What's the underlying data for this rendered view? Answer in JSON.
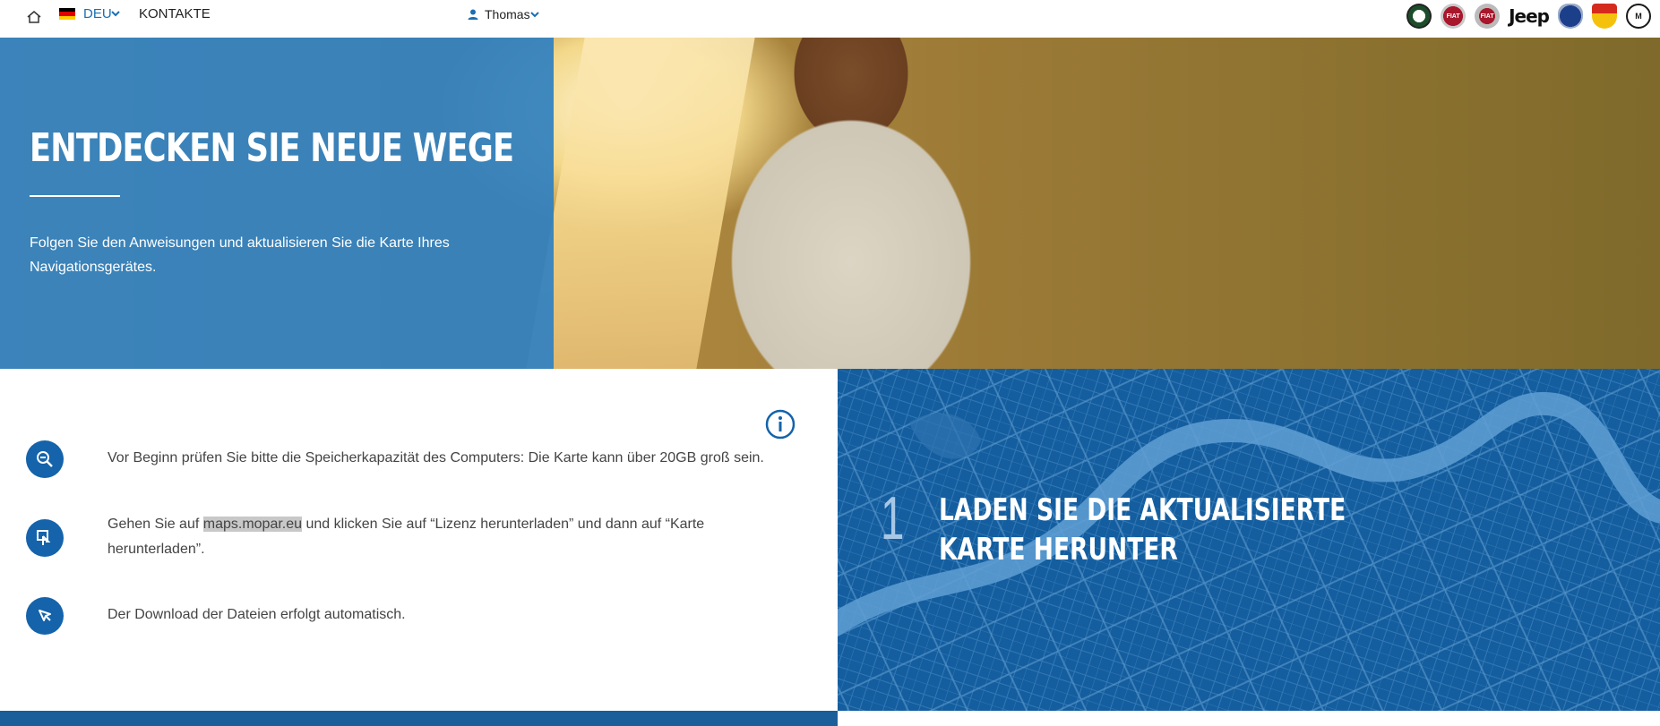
{
  "nav": {
    "language": "DEU",
    "contacts": "KONTAKTE",
    "user": "Thomas",
    "brands": [
      {
        "name": "alfa-romeo",
        "label": ""
      },
      {
        "name": "fiat",
        "label": "FIAT"
      },
      {
        "name": "fiat-professional",
        "label": "FIAT"
      },
      {
        "name": "jeep",
        "label": "Jeep"
      },
      {
        "name": "lancia",
        "label": ""
      },
      {
        "name": "abarth",
        "label": ""
      },
      {
        "name": "mopar",
        "label": "M"
      }
    ]
  },
  "hero": {
    "title": "ENTDECKEN SIE NEUE WEGE",
    "text": "Folgen Sie den Anweisungen und aktualisieren Sie die Karte Ihres Navigationsgerätes."
  },
  "steps": {
    "s1": "Vor Beginn prüfen Sie bitte die Speicherkapazität des Computers: Die Karte kann über 20GB groß sein.",
    "s2_pre": "Gehen Sie auf ",
    "s2_link": "maps.mopar.eu",
    "s2_post": " und klicken Sie auf “Lizenz herunterladen” und dann auf “Karte herunterladen”.",
    "s3": "Der Download der Dateien erfolgt automatisch."
  },
  "map_panel": {
    "number": "1",
    "title_line1": "LADEN SIE DIE AKTUALISIERTE",
    "title_line2": "KARTE HERUNTER"
  },
  "colors": {
    "accent": "#1463ab",
    "hero_overlay": "#2f80c1",
    "map_bg": "#145e9f"
  }
}
